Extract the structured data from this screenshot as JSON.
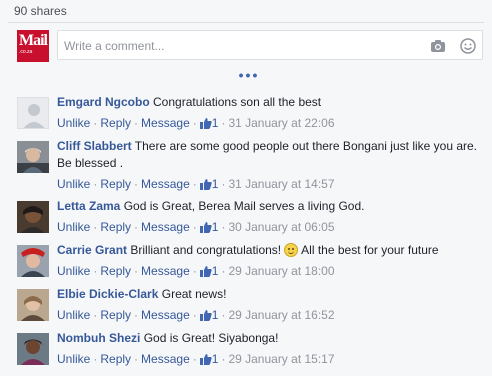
{
  "shares": "90 shares",
  "composer": {
    "placeholder": "Write a comment...",
    "avatar_logo": "Mail",
    "avatar_sub": ".co.za"
  },
  "colors": {
    "link": "#365899",
    "meta": "#90949c",
    "brand_red": "#c8102e"
  },
  "actions": {
    "unlike": "Unlike",
    "reply": "Reply",
    "message": "Message",
    "separator": "·"
  },
  "comments": [
    {
      "name": "Emgard Ngcobo",
      "text": "Congratulations son all the best",
      "likes": "1",
      "time": "31 January at 22:06",
      "avatar": "default-avatar"
    },
    {
      "name": "Cliff Slabbert",
      "text": "There are some good people out there Bongani just like you are. Be blessed .",
      "likes": "1",
      "time": "31 January at 14:57",
      "avatar": "photo-avatar"
    },
    {
      "name": "Letta Zama",
      "text": "God is Great, Berea Mail serves a living God.",
      "likes": "1",
      "time": "30 January at 06:05",
      "avatar": "photo-avatar"
    },
    {
      "name": "Carrie Grant",
      "text_before": "Brilliant and congratulations!",
      "emoji": "smile-emoji",
      "text_after": "All the best for your future",
      "likes": "1",
      "time": "29 January at 18:00",
      "avatar": "photo-avatar"
    },
    {
      "name": "Elbie Dickie-Clark",
      "text": "Great news!",
      "likes": "1",
      "time": "29 January at 16:52",
      "avatar": "photo-avatar"
    },
    {
      "name": "Nombuh Shezi",
      "text": "God is Great! Siyabonga!",
      "likes": "1",
      "time": "29 January at 15:17",
      "avatar": "photo-avatar"
    }
  ]
}
